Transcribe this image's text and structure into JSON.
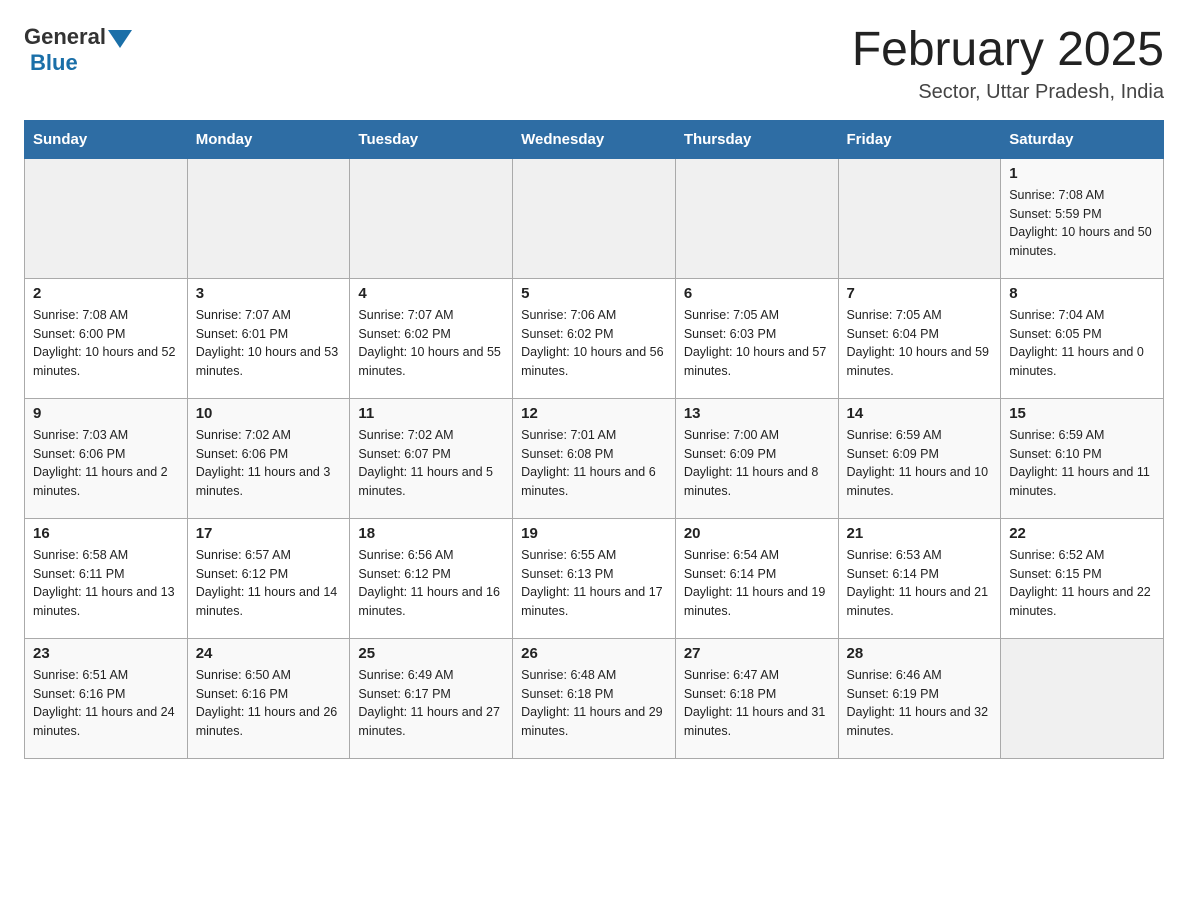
{
  "header": {
    "logo_general": "General",
    "logo_blue": "Blue",
    "title": "February 2025",
    "subtitle": "Sector, Uttar Pradesh, India"
  },
  "days_of_week": [
    "Sunday",
    "Monday",
    "Tuesday",
    "Wednesday",
    "Thursday",
    "Friday",
    "Saturday"
  ],
  "weeks": [
    [
      {
        "day": "",
        "sunrise": "",
        "sunset": "",
        "daylight": ""
      },
      {
        "day": "",
        "sunrise": "",
        "sunset": "",
        "daylight": ""
      },
      {
        "day": "",
        "sunrise": "",
        "sunset": "",
        "daylight": ""
      },
      {
        "day": "",
        "sunrise": "",
        "sunset": "",
        "daylight": ""
      },
      {
        "day": "",
        "sunrise": "",
        "sunset": "",
        "daylight": ""
      },
      {
        "day": "",
        "sunrise": "",
        "sunset": "",
        "daylight": ""
      },
      {
        "day": "1",
        "sunrise": "Sunrise: 7:08 AM",
        "sunset": "Sunset: 5:59 PM",
        "daylight": "Daylight: 10 hours and 50 minutes."
      }
    ],
    [
      {
        "day": "2",
        "sunrise": "Sunrise: 7:08 AM",
        "sunset": "Sunset: 6:00 PM",
        "daylight": "Daylight: 10 hours and 52 minutes."
      },
      {
        "day": "3",
        "sunrise": "Sunrise: 7:07 AM",
        "sunset": "Sunset: 6:01 PM",
        "daylight": "Daylight: 10 hours and 53 minutes."
      },
      {
        "day": "4",
        "sunrise": "Sunrise: 7:07 AM",
        "sunset": "Sunset: 6:02 PM",
        "daylight": "Daylight: 10 hours and 55 minutes."
      },
      {
        "day": "5",
        "sunrise": "Sunrise: 7:06 AM",
        "sunset": "Sunset: 6:02 PM",
        "daylight": "Daylight: 10 hours and 56 minutes."
      },
      {
        "day": "6",
        "sunrise": "Sunrise: 7:05 AM",
        "sunset": "Sunset: 6:03 PM",
        "daylight": "Daylight: 10 hours and 57 minutes."
      },
      {
        "day": "7",
        "sunrise": "Sunrise: 7:05 AM",
        "sunset": "Sunset: 6:04 PM",
        "daylight": "Daylight: 10 hours and 59 minutes."
      },
      {
        "day": "8",
        "sunrise": "Sunrise: 7:04 AM",
        "sunset": "Sunset: 6:05 PM",
        "daylight": "Daylight: 11 hours and 0 minutes."
      }
    ],
    [
      {
        "day": "9",
        "sunrise": "Sunrise: 7:03 AM",
        "sunset": "Sunset: 6:06 PM",
        "daylight": "Daylight: 11 hours and 2 minutes."
      },
      {
        "day": "10",
        "sunrise": "Sunrise: 7:02 AM",
        "sunset": "Sunset: 6:06 PM",
        "daylight": "Daylight: 11 hours and 3 minutes."
      },
      {
        "day": "11",
        "sunrise": "Sunrise: 7:02 AM",
        "sunset": "Sunset: 6:07 PM",
        "daylight": "Daylight: 11 hours and 5 minutes."
      },
      {
        "day": "12",
        "sunrise": "Sunrise: 7:01 AM",
        "sunset": "Sunset: 6:08 PM",
        "daylight": "Daylight: 11 hours and 6 minutes."
      },
      {
        "day": "13",
        "sunrise": "Sunrise: 7:00 AM",
        "sunset": "Sunset: 6:09 PM",
        "daylight": "Daylight: 11 hours and 8 minutes."
      },
      {
        "day": "14",
        "sunrise": "Sunrise: 6:59 AM",
        "sunset": "Sunset: 6:09 PM",
        "daylight": "Daylight: 11 hours and 10 minutes."
      },
      {
        "day": "15",
        "sunrise": "Sunrise: 6:59 AM",
        "sunset": "Sunset: 6:10 PM",
        "daylight": "Daylight: 11 hours and 11 minutes."
      }
    ],
    [
      {
        "day": "16",
        "sunrise": "Sunrise: 6:58 AM",
        "sunset": "Sunset: 6:11 PM",
        "daylight": "Daylight: 11 hours and 13 minutes."
      },
      {
        "day": "17",
        "sunrise": "Sunrise: 6:57 AM",
        "sunset": "Sunset: 6:12 PM",
        "daylight": "Daylight: 11 hours and 14 minutes."
      },
      {
        "day": "18",
        "sunrise": "Sunrise: 6:56 AM",
        "sunset": "Sunset: 6:12 PM",
        "daylight": "Daylight: 11 hours and 16 minutes."
      },
      {
        "day": "19",
        "sunrise": "Sunrise: 6:55 AM",
        "sunset": "Sunset: 6:13 PM",
        "daylight": "Daylight: 11 hours and 17 minutes."
      },
      {
        "day": "20",
        "sunrise": "Sunrise: 6:54 AM",
        "sunset": "Sunset: 6:14 PM",
        "daylight": "Daylight: 11 hours and 19 minutes."
      },
      {
        "day": "21",
        "sunrise": "Sunrise: 6:53 AM",
        "sunset": "Sunset: 6:14 PM",
        "daylight": "Daylight: 11 hours and 21 minutes."
      },
      {
        "day": "22",
        "sunrise": "Sunrise: 6:52 AM",
        "sunset": "Sunset: 6:15 PM",
        "daylight": "Daylight: 11 hours and 22 minutes."
      }
    ],
    [
      {
        "day": "23",
        "sunrise": "Sunrise: 6:51 AM",
        "sunset": "Sunset: 6:16 PM",
        "daylight": "Daylight: 11 hours and 24 minutes."
      },
      {
        "day": "24",
        "sunrise": "Sunrise: 6:50 AM",
        "sunset": "Sunset: 6:16 PM",
        "daylight": "Daylight: 11 hours and 26 minutes."
      },
      {
        "day": "25",
        "sunrise": "Sunrise: 6:49 AM",
        "sunset": "Sunset: 6:17 PM",
        "daylight": "Daylight: 11 hours and 27 minutes."
      },
      {
        "day": "26",
        "sunrise": "Sunrise: 6:48 AM",
        "sunset": "Sunset: 6:18 PM",
        "daylight": "Daylight: 11 hours and 29 minutes."
      },
      {
        "day": "27",
        "sunrise": "Sunrise: 6:47 AM",
        "sunset": "Sunset: 6:18 PM",
        "daylight": "Daylight: 11 hours and 31 minutes."
      },
      {
        "day": "28",
        "sunrise": "Sunrise: 6:46 AM",
        "sunset": "Sunset: 6:19 PM",
        "daylight": "Daylight: 11 hours and 32 minutes."
      },
      {
        "day": "",
        "sunrise": "",
        "sunset": "",
        "daylight": ""
      }
    ]
  ]
}
